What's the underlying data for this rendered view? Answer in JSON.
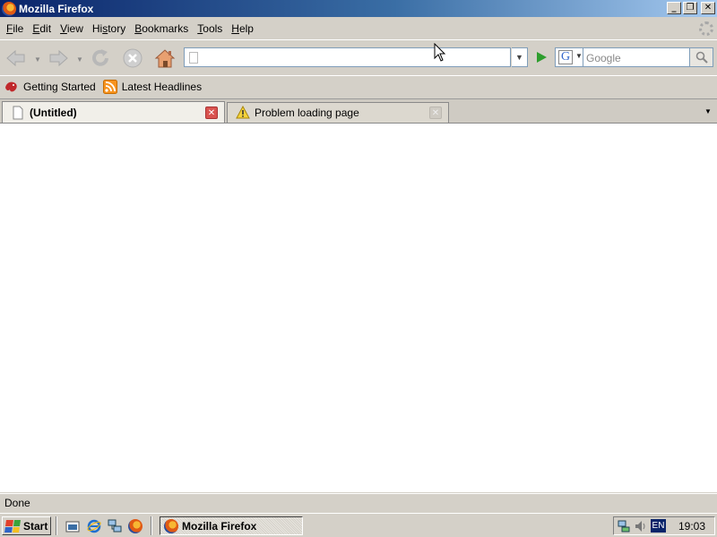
{
  "window": {
    "title": "Mozilla Firefox",
    "controls": {
      "minimize": "_",
      "restore": "❐",
      "close": "✕"
    }
  },
  "menubar": {
    "items": [
      {
        "pre": "",
        "key": "F",
        "post": "ile"
      },
      {
        "pre": "",
        "key": "E",
        "post": "dit"
      },
      {
        "pre": "",
        "key": "V",
        "post": "iew"
      },
      {
        "pre": "Hi",
        "key": "s",
        "post": "tory"
      },
      {
        "pre": "",
        "key": "B",
        "post": "ookmarks"
      },
      {
        "pre": "",
        "key": "T",
        "post": "ools"
      },
      {
        "pre": "",
        "key": "H",
        "post": "elp"
      }
    ]
  },
  "navigation": {
    "buttons": [
      "back-icon",
      "forward-icon",
      "reload-icon",
      "stop-icon",
      "home-icon"
    ],
    "url_value": "",
    "search": {
      "engine": "Google",
      "engine_icon": "G",
      "placeholder": "Google"
    }
  },
  "bookmarks": {
    "items": [
      {
        "label": "Getting Started",
        "icon": "firefox-bookmark-icon"
      },
      {
        "label": "Latest Headlines",
        "icon": "rss-feed-icon"
      }
    ]
  },
  "tabs": {
    "items": [
      {
        "label": "(Untitled)",
        "icon": "blank-page-icon",
        "active": true
      },
      {
        "label": "Problem loading page",
        "icon": "warning-icon",
        "active": false
      }
    ]
  },
  "statusbar": {
    "text": "Done"
  },
  "taskbar": {
    "start_label": "Start",
    "task_label": "Mozilla Firefox",
    "tray": {
      "lang": "EN",
      "clock": "19:03"
    }
  },
  "colors": {
    "titlebar_start": "#0a246a",
    "titlebar_end": "#a6caf0",
    "close_tab": "#d9534f",
    "go_arrow": "#2e9e2e"
  }
}
